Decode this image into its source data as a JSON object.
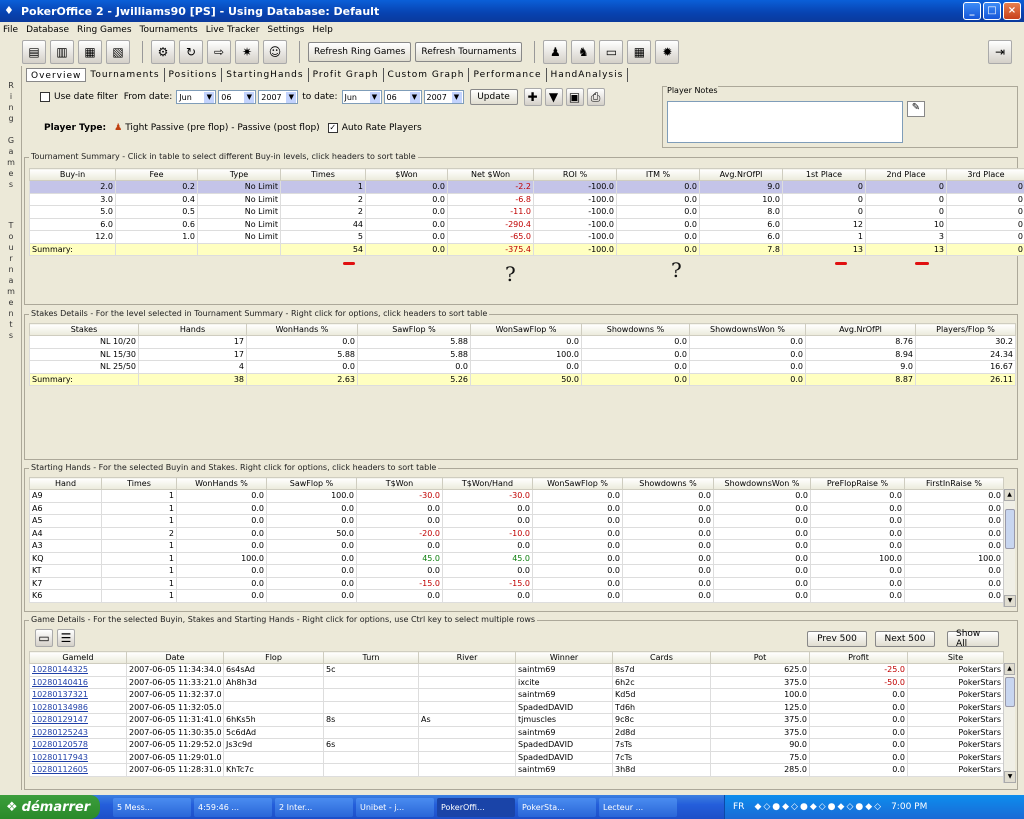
{
  "window": {
    "title": "PokerOffice 2 - Jwilliams90 [PS] - Using Database: Default"
  },
  "menu": [
    "File",
    "Database",
    "Ring Games",
    "Tournaments",
    "Live Tracker",
    "Settings",
    "Help"
  ],
  "toolbar": {
    "refresh_ring": "Refresh Ring Games",
    "refresh_tournaments": "Refresh Tournaments"
  },
  "left_tabs": {
    "ring": "R\ni\nn\ng\n\nG\na\nm\ne\ns",
    "tournaments": "T\no\nu\nr\nn\na\nm\ne\nn\nt\ns"
  },
  "tabs": [
    "Overview",
    "Tournaments",
    "Positions",
    "StartingHands",
    "Profit Graph",
    "Custom Graph",
    "Performance",
    "HandAnalysis"
  ],
  "filter": {
    "use_date": "Use date filter",
    "from": "From date:",
    "to": "to date:",
    "from_month": "Jun",
    "from_day": "06",
    "from_year": "2007",
    "to_month": "Jun",
    "to_day": "06",
    "to_year": "2007",
    "update": "Update"
  },
  "player": {
    "label": "Player Type:",
    "type": "Tight Passive (pre flop) - Passive (post flop)",
    "auto_rate": "Auto Rate Players",
    "notes_label": "Player Notes"
  },
  "tournament": {
    "title": "Tournament Summary - Click in table to select different Buy-in levels, click headers to sort table",
    "headers": [
      "Buy-in",
      "Fee",
      "Type",
      "Times",
      "$Won",
      "Net $Won",
      "ROI %",
      "ITM %",
      "Avg.NrOfPl",
      "1st Place",
      "2nd Place",
      "3rd Place"
    ],
    "rows": [
      [
        "2.0",
        "0.2",
        "No Limit",
        "1",
        "0.0",
        "-2.2",
        "-100.0",
        "0.0",
        "9.0",
        "0",
        "0",
        "0"
      ],
      [
        "3.0",
        "0.4",
        "No Limit",
        "2",
        "0.0",
        "-6.8",
        "-100.0",
        "0.0",
        "10.0",
        "0",
        "0",
        "0"
      ],
      [
        "5.0",
        "0.5",
        "No Limit",
        "2",
        "0.0",
        "-11.0",
        "-100.0",
        "0.0",
        "8.0",
        "0",
        "0",
        "0"
      ],
      [
        "6.0",
        "0.6",
        "No Limit",
        "44",
        "0.0",
        "-290.4",
        "-100.0",
        "0.0",
        "6.0",
        "12",
        "10",
        "0"
      ],
      [
        "12.0",
        "1.0",
        "No Limit",
        "5",
        "0.0",
        "-65.0",
        "-100.0",
        "0.0",
        "6.0",
        "1",
        "3",
        "0"
      ]
    ],
    "summary": [
      "Summary:",
      "",
      "",
      "54",
      "0.0",
      "-375.4",
      "-100.0",
      "0.0",
      "7.8",
      "13",
      "13",
      "0"
    ]
  },
  "annotations": [
    "?",
    "?"
  ],
  "stakes": {
    "title": "Stakes Details - For the level selected in Tournament Summary - Right click for options, click headers to sort table",
    "headers": [
      "Stakes",
      "Hands",
      "WonHands %",
      "SawFlop %",
      "WonSawFlop %",
      "Showdowns %",
      "ShowdownsWon %",
      "Avg.NrOfPl",
      "Players/Flop %"
    ],
    "rows": [
      [
        "NL 10/20",
        "17",
        "0.0",
        "5.88",
        "0.0",
        "0.0",
        "0.0",
        "8.76",
        "30.2"
      ],
      [
        "NL 15/30",
        "17",
        "5.88",
        "5.88",
        "100.0",
        "0.0",
        "0.0",
        "8.94",
        "24.34"
      ],
      [
        "NL 25/50",
        "4",
        "0.0",
        "0.0",
        "0.0",
        "0.0",
        "0.0",
        "9.0",
        "16.67"
      ]
    ],
    "summary": [
      "Summary:",
      "38",
      "2.63",
      "5.26",
      "50.0",
      "0.0",
      "0.0",
      "8.87",
      "26.11"
    ]
  },
  "hands": {
    "title": "Starting Hands - For the selected Buyin and Stakes. Right click for options, click headers to sort table",
    "headers": [
      "Hand",
      "Times",
      "WonHands %",
      "SawFlop %",
      "T$Won",
      "T$Won/Hand",
      "WonSawFlop %",
      "Showdowns %",
      "ShowdownsWon %",
      "PreFlopRaise %",
      "FirstInRaise %"
    ],
    "rows": [
      [
        "A9",
        "1",
        "0.0",
        "100.0",
        "-30.0",
        "-30.0",
        "0.0",
        "0.0",
        "0.0",
        "0.0",
        "0.0"
      ],
      [
        "A6",
        "1",
        "0.0",
        "0.0",
        "0.0",
        "0.0",
        "0.0",
        "0.0",
        "0.0",
        "0.0",
        "0.0"
      ],
      [
        "A5",
        "1",
        "0.0",
        "0.0",
        "0.0",
        "0.0",
        "0.0",
        "0.0",
        "0.0",
        "0.0",
        "0.0"
      ],
      [
        "A4",
        "2",
        "0.0",
        "50.0",
        "-20.0",
        "-10.0",
        "0.0",
        "0.0",
        "0.0",
        "0.0",
        "0.0"
      ],
      [
        "A3",
        "1",
        "0.0",
        "0.0",
        "0.0",
        "0.0",
        "0.0",
        "0.0",
        "0.0",
        "0.0",
        "0.0"
      ],
      [
        "KQ",
        "1",
        "100.0",
        "0.0",
        "45.0",
        "45.0",
        "0.0",
        "0.0",
        "0.0",
        "100.0",
        "100.0"
      ],
      [
        "KT",
        "1",
        "0.0",
        "0.0",
        "0.0",
        "0.0",
        "0.0",
        "0.0",
        "0.0",
        "0.0",
        "0.0"
      ],
      [
        "K7",
        "1",
        "0.0",
        "0.0",
        "-15.0",
        "-15.0",
        "0.0",
        "0.0",
        "0.0",
        "0.0",
        "0.0"
      ],
      [
        "K6",
        "1",
        "0.0",
        "0.0",
        "0.0",
        "0.0",
        "0.0",
        "0.0",
        "0.0",
        "0.0",
        "0.0"
      ]
    ]
  },
  "games": {
    "title": "Game Details - For the selected Buyin, Stakes and Starting Hands - Right click for options, use Ctrl key to select multiple rows",
    "prev": "Prev 500",
    "next": "Next 500",
    "show_all": "Show All",
    "headers": [
      "GameId",
      "Date",
      "Flop",
      "Turn",
      "River",
      "Winner",
      "Cards",
      "Pot",
      "Profit",
      "Site"
    ],
    "rows": [
      [
        "10280144325",
        "2007-06-05 11:34:34.0",
        "6s4sAd",
        "5c",
        "",
        "saintm69",
        "8s7d",
        "625.0",
        "-25.0",
        "PokerStars"
      ],
      [
        "10280140416",
        "2007-06-05 11:33:21.0",
        "Ah8h3d",
        "",
        "",
        "ixcite",
        "6h2c",
        "375.0",
        "-50.0",
        "PokerStars"
      ],
      [
        "10280137321",
        "2007-06-05 11:32:37.0",
        "",
        "",
        "",
        "saintm69",
        "Kd5d",
        "100.0",
        "0.0",
        "PokerStars"
      ],
      [
        "10280134986",
        "2007-06-05 11:32:05.0",
        "",
        "",
        "",
        "SpadedDAVID",
        "Td6h",
        "125.0",
        "0.0",
        "PokerStars"
      ],
      [
        "10280129147",
        "2007-06-05 11:31:41.0",
        "6hKs5h",
        "8s",
        "As",
        "tjmuscles",
        "9c8c",
        "375.0",
        "0.0",
        "PokerStars"
      ],
      [
        "10280125243",
        "2007-06-05 11:30:35.0",
        "5c6dAd",
        "",
        "",
        "saintm69",
        "2d8d",
        "375.0",
        "0.0",
        "PokerStars"
      ],
      [
        "10280120578",
        "2007-06-05 11:29:52.0",
        "Js3c9d",
        "6s",
        "",
        "SpadedDAVID",
        "7sTs",
        "90.0",
        "0.0",
        "PokerStars"
      ],
      [
        "10280117943",
        "2007-06-05 11:29:01.0",
        "",
        "",
        "",
        "SpadedDAVID",
        "7cTs",
        "75.0",
        "0.0",
        "PokerStars"
      ],
      [
        "10280112605",
        "2007-06-05 11:28:31.0",
        "KhTc7c",
        "",
        "",
        "saintm69",
        "3h8d",
        "285.0",
        "0.0",
        "PokerStars"
      ]
    ]
  },
  "taskbar": {
    "start": "démarrer",
    "tasks": [
      "5 Mess...",
      "4:59:46 ...",
      "2 Inter...",
      "Unibet - j...",
      "PokerOffi...",
      "PokerSta...",
      "Lecteur ..."
    ],
    "lang": "FR",
    "clock": "7:00 PM"
  }
}
